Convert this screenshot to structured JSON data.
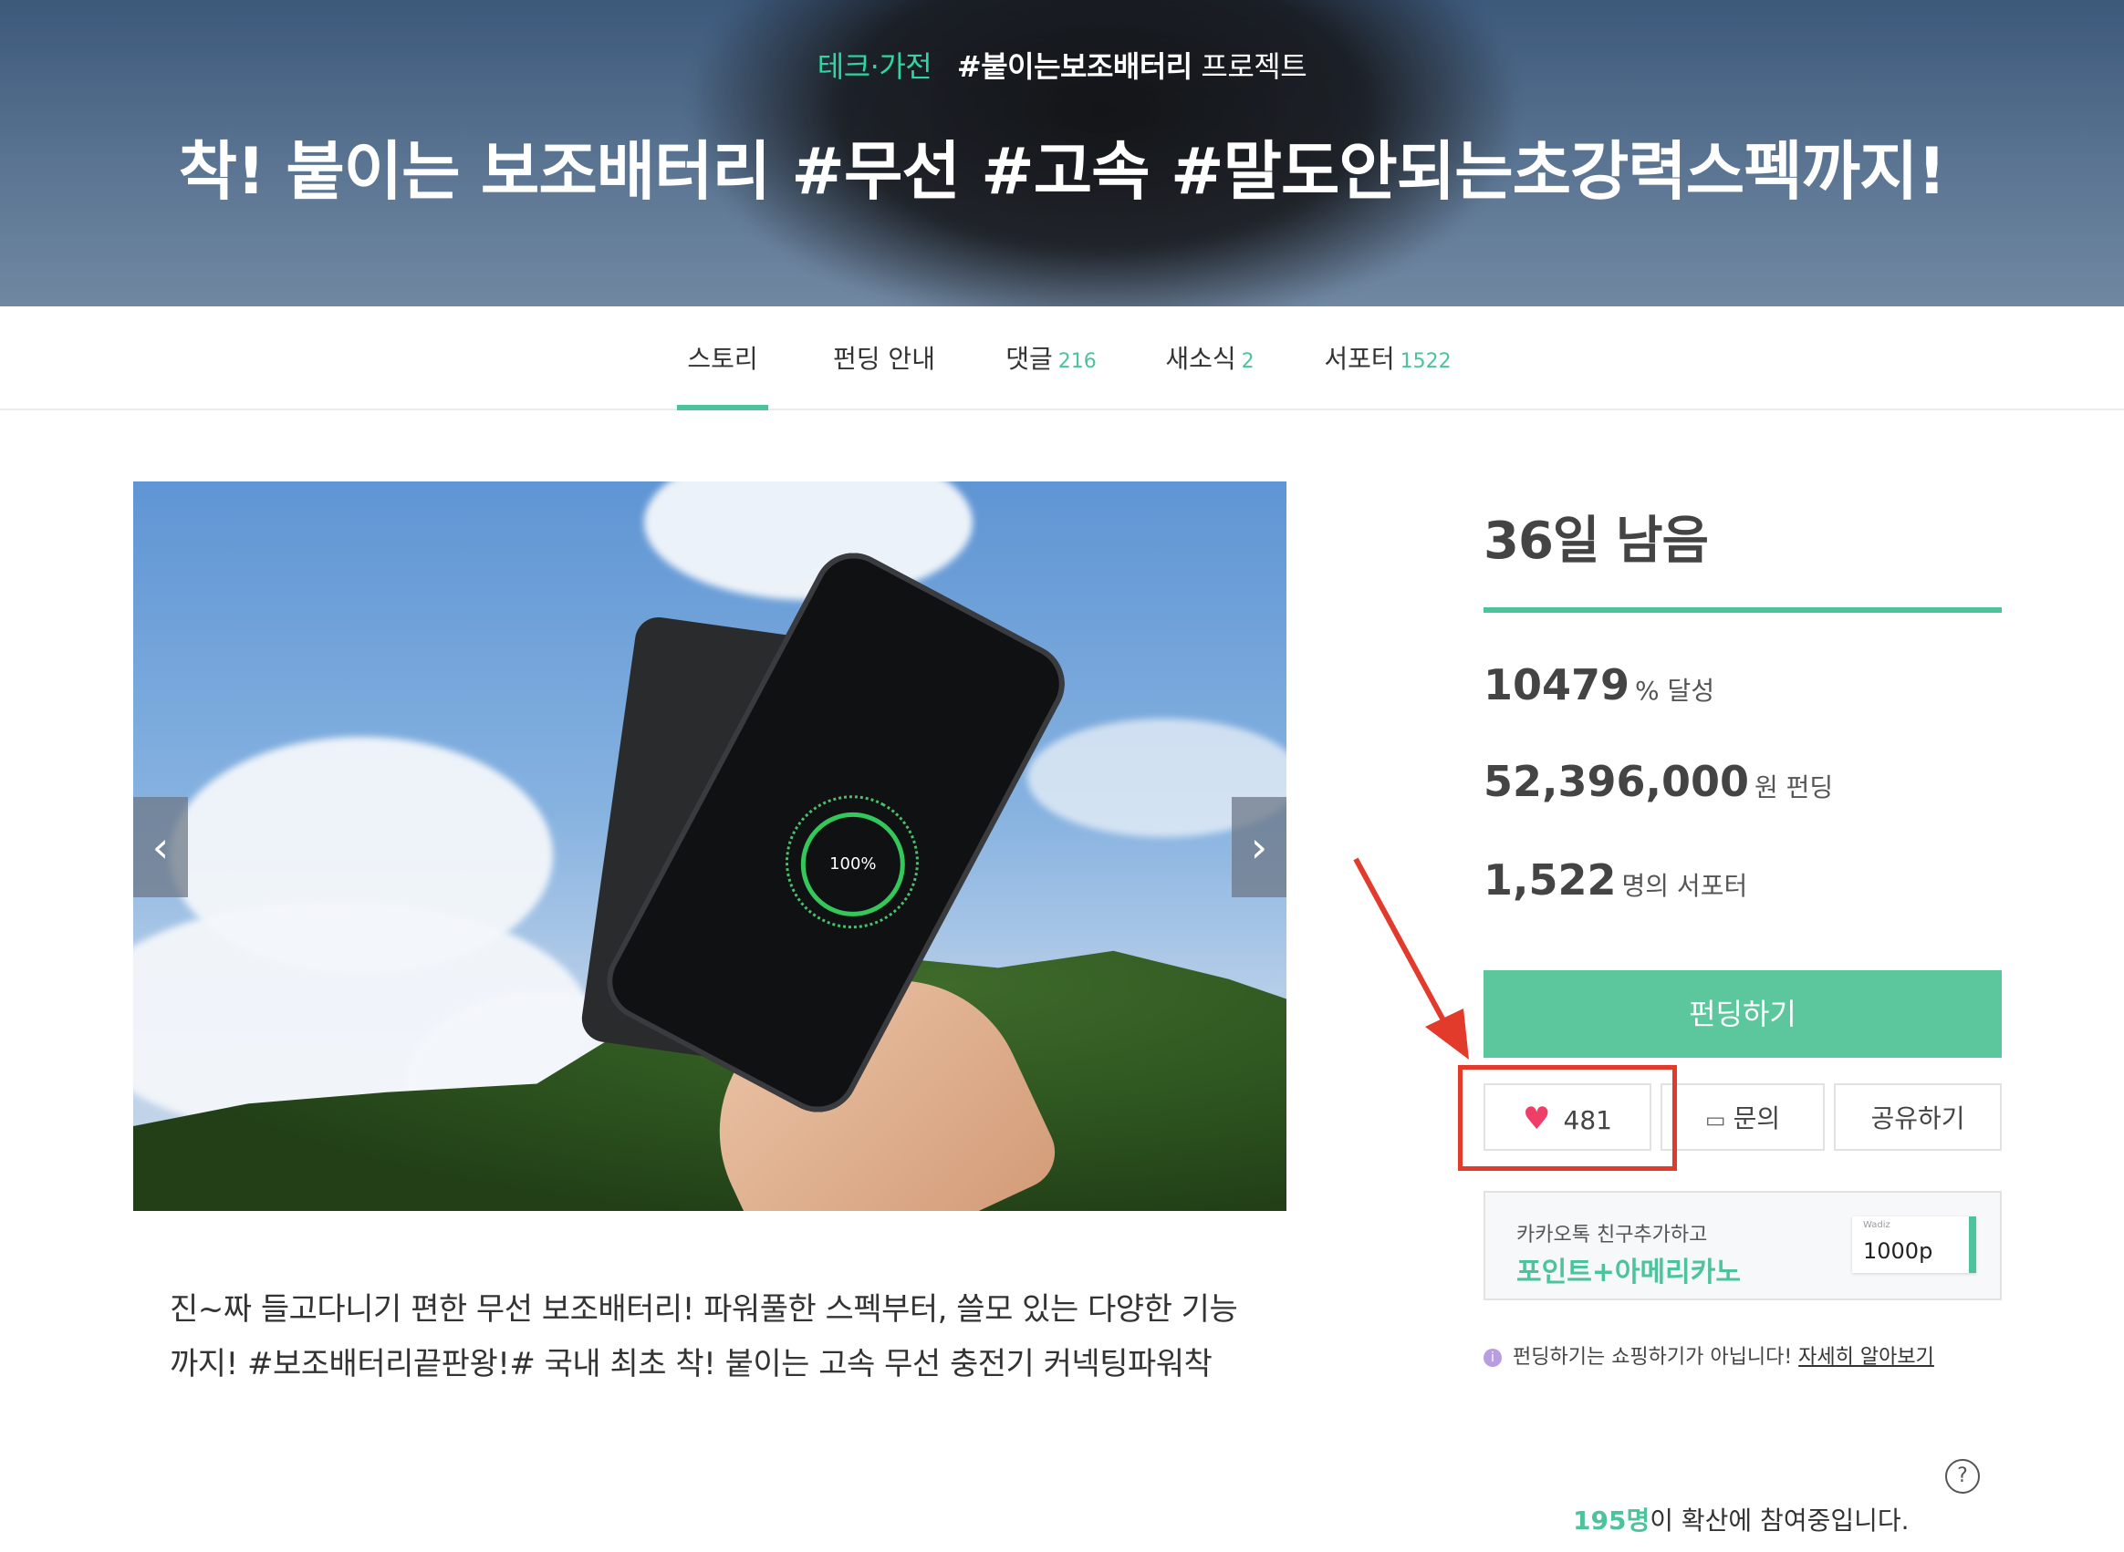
{
  "hero": {
    "category": "테크·가전",
    "hashtag": "#붙이는보조배터리",
    "suffix": "프로젝트",
    "title": "착! 붙이는 보조배터리 #무선 #고속 #말도안되는초강력스펙까지!"
  },
  "tabs": [
    {
      "label": "스토리",
      "count": "",
      "active": true
    },
    {
      "label": "펀딩 안내",
      "count": ""
    },
    {
      "label": "댓글",
      "count": "216"
    },
    {
      "label": "새소식",
      "count": "2"
    },
    {
      "label": "서포터",
      "count": "1522"
    }
  ],
  "slider": {
    "prev_icon": "chevron-left-icon",
    "next_icon": "chevron-right-icon",
    "prev_glyph": "‹",
    "next_glyph": "›",
    "charge_label": "100%"
  },
  "description": "진~짜 들고다니기 편한 무선 보조배터리! 파워풀한 스펙부터, 쓸모 있는 다양한 기능까지! #보조배터리끝판왕!# 국내 최초 착! 붙이는 고속 무선 충전기 커넥팅파워착",
  "sidebar": {
    "days_left": "36일 남음",
    "achievement_value": "10479",
    "achievement_unit": "% 달성",
    "amount_value": "52,396,000",
    "amount_unit": "원 펀딩",
    "supporters_value": "1,522",
    "supporters_unit": "명의 서포터",
    "fund_button": "펀딩하기",
    "like_count": "481",
    "inquiry_label": "문의",
    "share_label": "공유하기",
    "kakao_line1": "카카오톡 친구추가하고",
    "kakao_line2": "포인트+아메리카노",
    "coupon_brand": "Wadiz",
    "coupon_points": "1000p",
    "notice_text": "펀딩하기는 쇼핑하기가 아닙니다!",
    "notice_link": "자세히 알아보기",
    "help_glyph": "?",
    "spread_count": "195명",
    "spread_text": "이 확산에 참여중입니다."
  },
  "colors": {
    "accent": "#4cc39a",
    "fund_button": "#5cc79c",
    "heart": "#ef3e67",
    "annotation": "#e23a2b"
  }
}
